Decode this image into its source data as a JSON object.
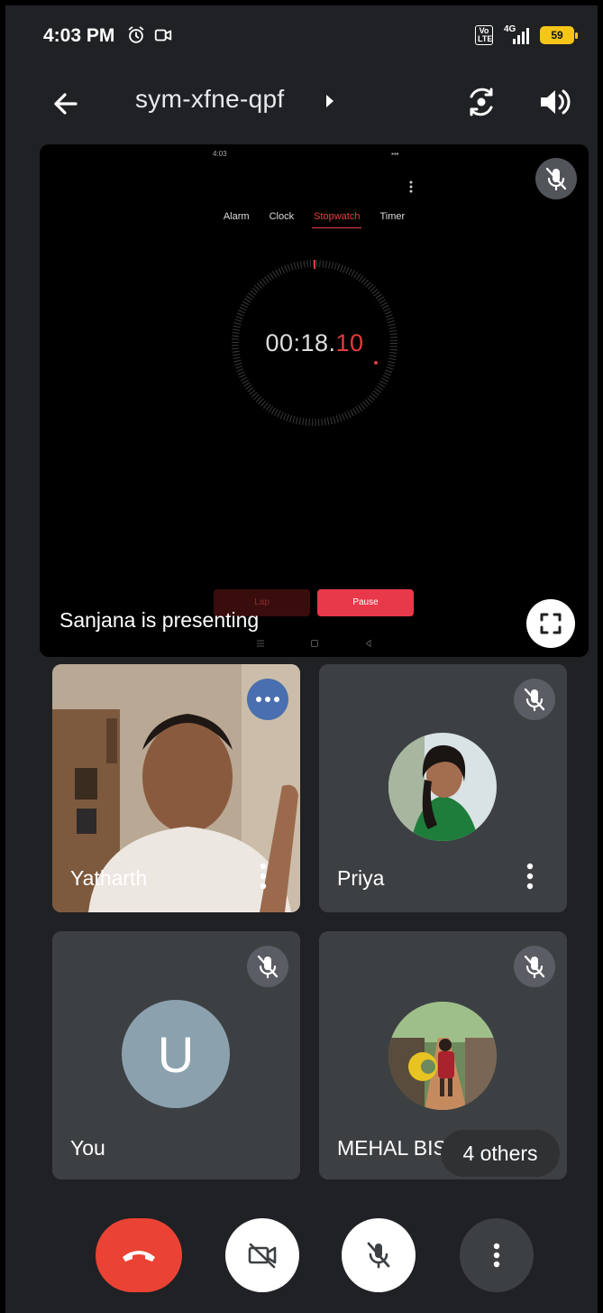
{
  "status_bar": {
    "time": "4:03 PM",
    "lte_label": "Vo LTE",
    "network_label": "4G",
    "battery_level": "59",
    "icons": [
      "alarm-icon",
      "video-record-icon",
      "signal-icon",
      "battery-icon"
    ]
  },
  "header": {
    "meeting_code": "sym-xfne-qpf",
    "icons": [
      "back-arrow-icon",
      "caret-right-icon",
      "flip-camera-icon",
      "speaker-icon"
    ]
  },
  "presentation": {
    "presenter_label": "Sanjana is presenting",
    "shared_screen": {
      "mini_time": "4:03",
      "tabs": [
        "Alarm",
        "Clock",
        "Stopwatch",
        "Timer"
      ],
      "active_tab": "Stopwatch",
      "stopwatch_main": "00:18.",
      "stopwatch_ms": "10",
      "lap_label": "Lap",
      "pause_label": "Pause"
    }
  },
  "participants": [
    {
      "name": "Yatharth",
      "muted": false,
      "video": true
    },
    {
      "name": "Priya",
      "muted": true,
      "video": false
    },
    {
      "name": "You",
      "initial": "U",
      "muted": true,
      "video": false
    },
    {
      "name": "MEHAL BISHT",
      "muted": true,
      "video": false
    }
  ],
  "others_chip": "4 others",
  "controls": [
    "end-call",
    "camera-off",
    "mic-off",
    "more-options"
  ],
  "colors": {
    "background": "#202124",
    "tile": "#3c4043",
    "end_call": "#ea4335",
    "accent_red": "#e23b3b",
    "avatar_bg": "#8ba1ae",
    "battery": "#f5c518"
  }
}
